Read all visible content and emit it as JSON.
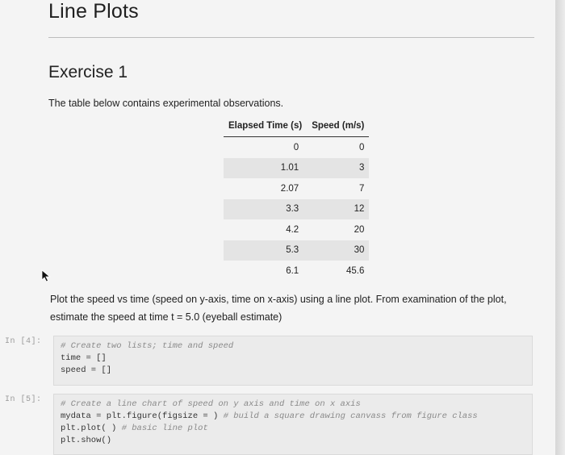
{
  "notebook": {
    "section_title": "Line Plots",
    "exercise_title": "Exercise 1",
    "intro_text": "The table below contains experimental observations.",
    "table": {
      "headers": [
        "Elapsed Time (s)",
        "Speed (m/s)"
      ],
      "rows": [
        [
          "0",
          "0"
        ],
        [
          "1.01",
          "3"
        ],
        [
          "2.07",
          "7"
        ],
        [
          "3.3",
          "12"
        ],
        [
          "4.2",
          "20"
        ],
        [
          "5.3",
          "30"
        ],
        [
          "6.1",
          "45.6"
        ]
      ]
    },
    "instruction": "Plot the speed vs time (speed on y-axis, time on x-axis) using a line plot. From examination of the plot, estimate the speed at time t = 5.0 (eyeball estimate)"
  },
  "cells": [
    {
      "prompt": "In [4]:",
      "lines": [
        {
          "code": "",
          "comment": "# Create two lists; time and speed"
        },
        {
          "code": "time = []",
          "comment": ""
        },
        {
          "code": "speed = []",
          "comment": ""
        }
      ]
    },
    {
      "prompt": "In [5]:",
      "lines": [
        {
          "code": "",
          "comment": "# Create a line chart of speed on y axis and time on x axis"
        },
        {
          "code": "mydata = plt.figure(figsize = )",
          "comment": "# build a square drawing canvass from figure class"
        },
        {
          "code": "plt.plot( )",
          "comment": "# basic line plot"
        },
        {
          "code": "plt.show()",
          "comment": ""
        }
      ]
    }
  ],
  "colors": {
    "page_background": "#f4f4f4",
    "cell_background": "#ebebeb",
    "table_stripe": "#e4e4e4",
    "prompt_text": "#9a9a9a",
    "comment_text": "#8a8a8a"
  },
  "icons": {
    "cursor": "mouse-pointer-icon"
  }
}
